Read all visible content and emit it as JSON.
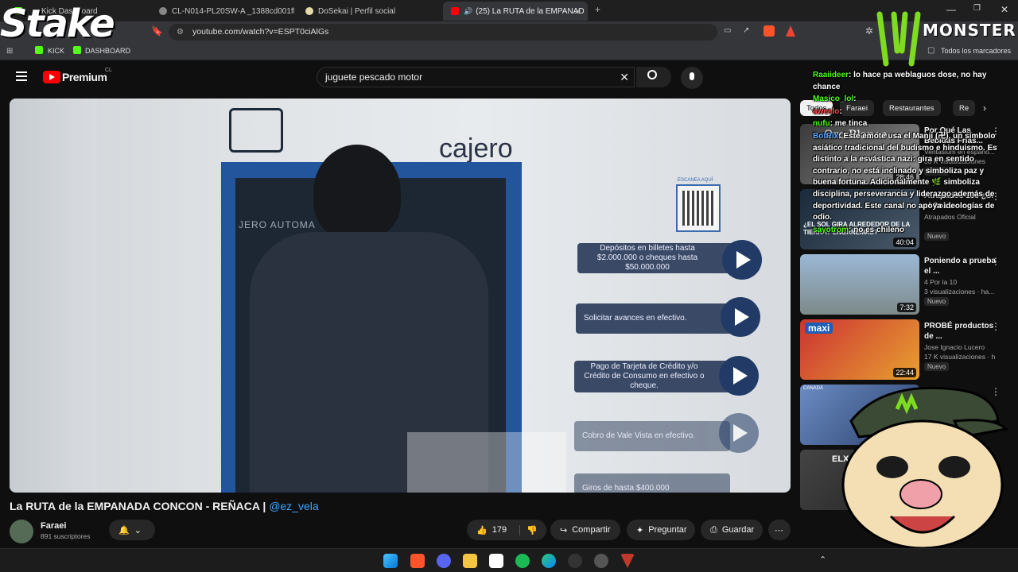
{
  "browser": {
    "tabs": [
      {
        "label": "Kick Dashboard",
        "icon": "kick-icon"
      },
      {
        "label": "CL-N014-PL20SW-A _1388cd001ff64",
        "icon": "globe-icon"
      },
      {
        "label": "DoSekai | Perfil social",
        "icon": "dosekai-icon"
      },
      {
        "label": "(25) La RUTA de la EMPANAD",
        "icon": "youtube-icon"
      }
    ],
    "url": "youtube.com/watch?v=ESPT0ciAlGs",
    "bookmarks": [
      "KICK",
      "DASHBOARD"
    ],
    "all_bookmarks": "Todos los marcadores"
  },
  "youtube": {
    "logo": "Premium",
    "region": "CL",
    "search_query": "juguete pescado motor"
  },
  "video_scene": {
    "atm_brand": "cajero",
    "atm_screen_text": "JERO AUTOMA",
    "qr_caption": "ESCANEA AQUÍ",
    "options": [
      "Depósitos en billetes hasta $2.000.000 o cheques hasta $50.000.000",
      "Solicitar avances en efectivo.",
      "Pago de Tarjeta de Crédito y/o Crédito de Consumo en efectivo o cheque.",
      "Cobro de Vale Vista en efectivo.",
      "Giros de hasta $400.000"
    ]
  },
  "video": {
    "title": "La RUTA de la EMPANADA CONCON - REÑACA |",
    "handle": "@ez_vela",
    "channel": "Faraei",
    "subscribers": "891 suscriptores",
    "likes": "179",
    "share": "Compartir",
    "ask": "Preguntar",
    "save": "Guardar"
  },
  "sidebar": {
    "chips": [
      "Todos",
      "Faraei",
      "Restaurantes",
      "Re"
    ],
    "recs": [
      {
        "title": "Por Qué Las Bebidas Frías...",
        "channel": "Ventasium en españo...",
        "views": "33 K visualizaciones",
        "duration": "28:46",
        "badge": "Nuevo",
        "thumb_text": "Oro Blanco"
      },
      {
        "title": "Atrapados 133 ¿Si el Sol...",
        "channel": "Atrapados Oficial",
        "views": "",
        "duration": "40:04",
        "badge": "Nuevo",
        "thumb_text": "¿EL SOL GIRA ALREDEDOR DE LA TIERRA? ENGAÑEMAS?"
      },
      {
        "title": "Poniendo a prueba el ...",
        "channel": "4 Por la 10",
        "views": "3 visualizaciones · ha...",
        "duration": "7:32",
        "badge": "Nuevo",
        "thumb_text": ""
      },
      {
        "title": "PROBÉ productos de ...",
        "channel": "Jose Ignacio Lucero",
        "views": "17 K visualizaciones · h",
        "duration": "22:44",
        "badge": "Nuevo",
        "thumb_text": "maxi"
      },
      {
        "title": "",
        "channel": "",
        "views": "",
        "duration": "",
        "badge": "",
        "thumb_text": "CANADÁ"
      },
      {
        "title": "",
        "channel": "",
        "views": "",
        "duration": "",
        "badge": "",
        "thumb_text": "ELX"
      }
    ]
  },
  "chat": [
    {
      "user": "Raaiideer",
      "text": ": lo hace pa weblaguos dose, no hay chance",
      "color": "#53fc18"
    },
    {
      "user": "Masico_lol",
      "text": ":",
      "color": "#53fc18"
    },
    {
      "user": "aweelo",
      "text": ":",
      "color": "#ff4a4a"
    },
    {
      "user": "nufu",
      "text": ": me tinca",
      "color": "#53fc18"
    },
    {
      "user": "BotRix",
      "text": ": Este emote usa el Manji (卍), un símbolo asiático tradicional del budismo e hinduismo. Es distinto a la esvástica nazi: gira en sentido contrario, no está inclinado y simboliza paz y buena fortuna. Adicionalmente 🌿 simboliza disciplina, perseverancia y liderazgo además de deportividad. Este canal no apoya ideologías de odio.",
      "color": "#5aa8ff"
    },
    {
      "user": "sayotrom",
      "text": ": no es chileno",
      "color": "#53fc18"
    }
  ],
  "overlay": {
    "stake_logo": "Stake",
    "monster_text": "MONSTER"
  },
  "colors": {
    "kick_green": "#53fc18",
    "youtube_red": "#ff0000",
    "link_blue": "#3ea6ff",
    "atm_blue": "#23559c"
  }
}
